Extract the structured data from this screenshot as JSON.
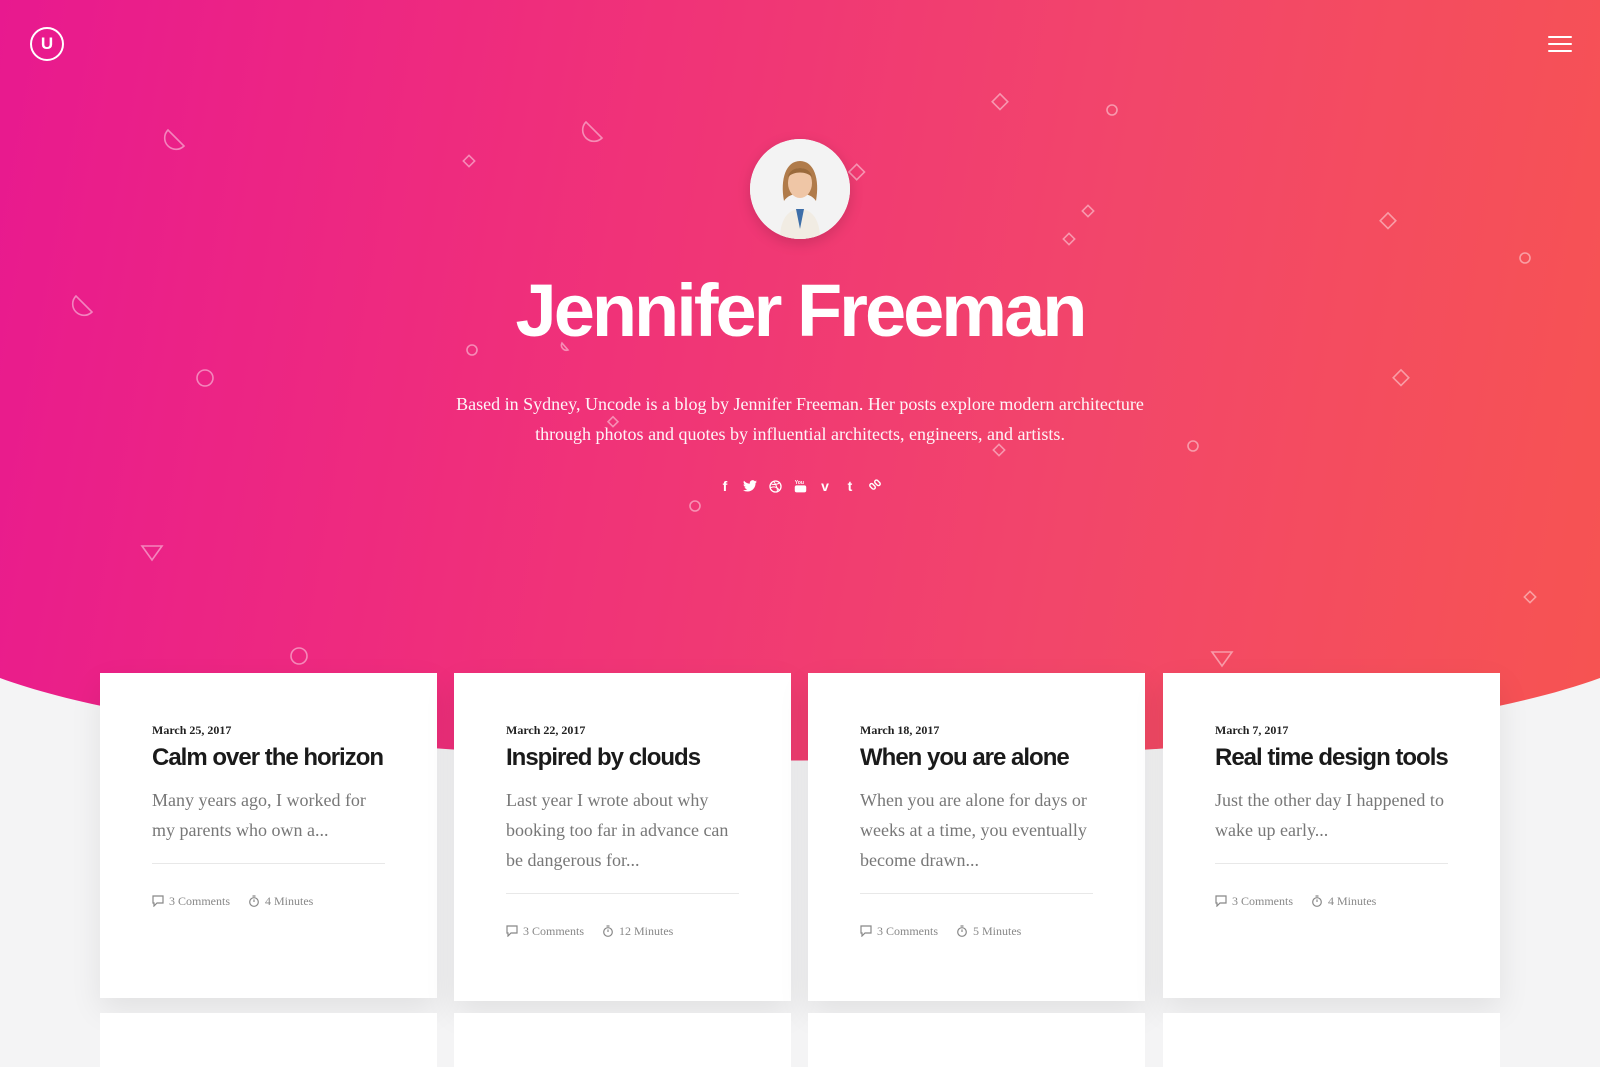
{
  "brand": {
    "logo_letter": "U"
  },
  "nav": {
    "menu_icon": "hamburger-icon"
  },
  "profile": {
    "name": "Jennifer Freeman",
    "bio_line1": "Based in Sydney, Uncode is a blog by Jennifer Freeman. Her posts explore modern architecture",
    "bio_line2": "through photos and quotes by influential architects, engineers, and artists."
  },
  "social": [
    {
      "icon": "facebook-icon",
      "glyph": "f"
    },
    {
      "icon": "twitter-icon",
      "glyph": ""
    },
    {
      "icon": "dribbble-icon",
      "glyph": ""
    },
    {
      "icon": "youtube-icon",
      "glyph": ""
    },
    {
      "icon": "vimeo-icon",
      "glyph": "v"
    },
    {
      "icon": "tumblr-icon",
      "glyph": "t"
    },
    {
      "icon": "link-icon",
      "glyph": ""
    }
  ],
  "posts": [
    {
      "date": "March 25, 2017",
      "title": "Calm over the horizon",
      "excerpt": "Many years ago, I worked for my parents who own a...",
      "comments": "3 Comments",
      "read_time": "4 Minutes"
    },
    {
      "date": "March 22, 2017",
      "title": "Inspired by clouds",
      "excerpt": "Last year I wrote about why booking too far in advance can be dangerous for...",
      "comments": "3 Comments",
      "read_time": "12 Minutes"
    },
    {
      "date": "March 18, 2017",
      "title": "When you are alone",
      "excerpt": "When you are alone for days or weeks at a time, you eventually become drawn...",
      "comments": "3 Comments",
      "read_time": "5 Minutes"
    },
    {
      "date": "March 7, 2017",
      "title": "Real time design tools",
      "excerpt": "Just the other day I happened to wake up early...",
      "comments": "3 Comments",
      "read_time": "4 Minutes"
    }
  ],
  "colors": {
    "gradient_start": "#e8198f",
    "gradient_end": "#f7554f",
    "background": "#f4f4f5"
  }
}
